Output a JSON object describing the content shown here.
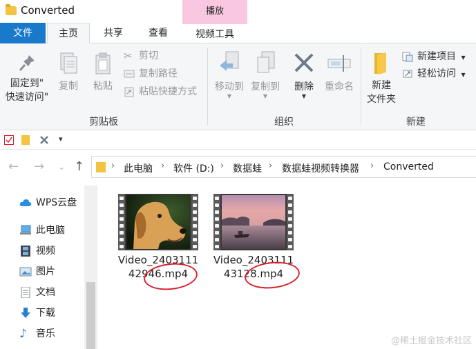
{
  "window": {
    "title": "Converted"
  },
  "context_tab_header": "播放",
  "tabs": {
    "file": "文件",
    "home": "主页",
    "share": "共享",
    "view": "查看",
    "video_tools": "视频工具"
  },
  "ribbon": {
    "clipboard": {
      "pin_line1": "固定到\"",
      "pin_line2": "快速访问\"",
      "copy": "复制",
      "paste": "粘贴",
      "cut": "剪切",
      "copy_path": "复制路径",
      "paste_shortcut": "粘贴快捷方式",
      "group_label": "剪贴板"
    },
    "organize": {
      "move_to": "移动到",
      "copy_to": "复制到",
      "delete": "删除",
      "rename": "重命名",
      "group_label": "组织"
    },
    "new": {
      "new_folder_line1": "新建",
      "new_folder_line2": "文件夹",
      "new_item": "新建项目",
      "easy_access": "轻松访问",
      "group_label": "新建"
    }
  },
  "breadcrumb": [
    "此电脑",
    "软件 (D:)",
    "数据蛙",
    "数据蛙视频转换器",
    "Converted"
  ],
  "nav_pane": [
    "WPS云盘",
    "此电脑",
    "视频",
    "图片",
    "文档",
    "下载",
    "音乐"
  ],
  "files": [
    {
      "line1": "Video_2403111",
      "line2": "42946.mp4",
      "thumb": "dog"
    },
    {
      "line1": "Video_2403111",
      "line2": "43128.mp4",
      "thumb": "sunset"
    }
  ],
  "watermark": "@稀土掘金技术社区",
  "colors": {
    "accent": "#1979ca",
    "context_tab": "#f9c8e0",
    "annotation": "#d9232d"
  }
}
